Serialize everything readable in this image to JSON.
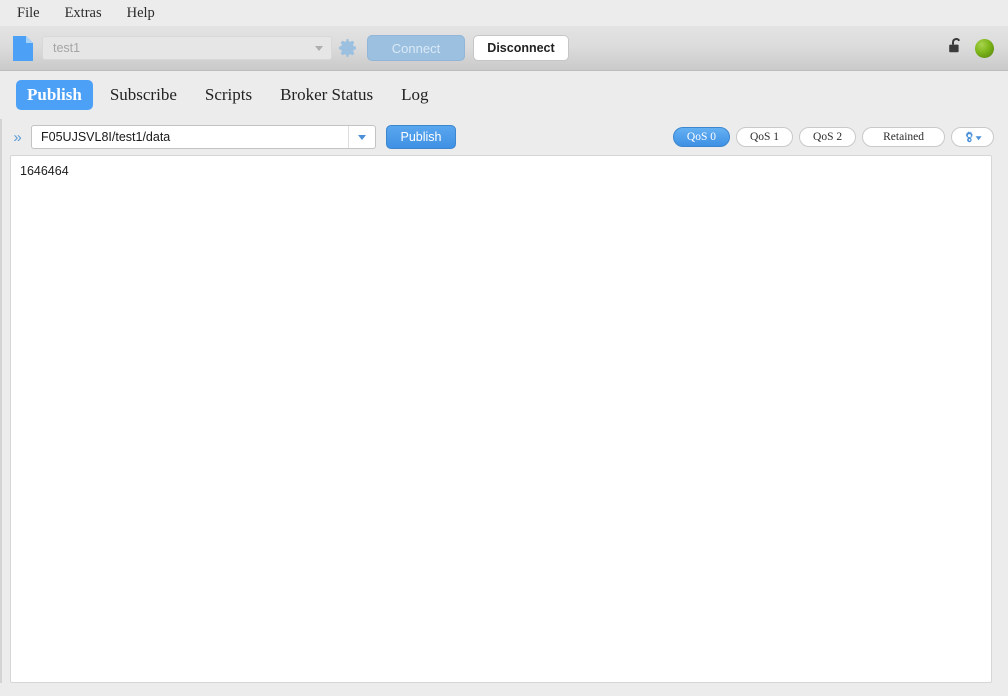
{
  "menubar": {
    "items": [
      {
        "label": "File",
        "name": "menu-file"
      },
      {
        "label": "Extras",
        "name": "menu-extras"
      },
      {
        "label": "Help",
        "name": "menu-help"
      }
    ]
  },
  "toolbar": {
    "document_icon": "document-icon",
    "profile": {
      "value": "test1",
      "placeholder": "test1"
    },
    "settings_icon": "gear-icon",
    "connect_label": "Connect",
    "disconnect_label": "Disconnect",
    "lock_icon": "unlocked-padlock-icon",
    "status_indicator": "connection-status-dot",
    "accent_color": "#4ca1f7",
    "status_color": "#7cb518"
  },
  "tabs": [
    {
      "label": "Publish",
      "name": "tab-publish",
      "active": true
    },
    {
      "label": "Subscribe",
      "name": "tab-subscribe",
      "active": false
    },
    {
      "label": "Scripts",
      "name": "tab-scripts",
      "active": false
    },
    {
      "label": "Broker Status",
      "name": "tab-broker-status",
      "active": false
    },
    {
      "label": "Log",
      "name": "tab-log",
      "active": false
    }
  ],
  "publish": {
    "expand_icon": "»",
    "topic": "F05UJSVL8I/test1/data",
    "topic_placeholder": "Topic",
    "publish_label": "Publish",
    "options": [
      {
        "label": "QoS 0",
        "name": "qos-0-button",
        "selected": true
      },
      {
        "label": "QoS 1",
        "name": "qos-1-button",
        "selected": false
      },
      {
        "label": "QoS 2",
        "name": "qos-2-button",
        "selected": false
      },
      {
        "label": "Retained",
        "name": "retained-button",
        "selected": false
      }
    ],
    "settings_button": "publish-settings-icon",
    "payload": "1646464"
  }
}
